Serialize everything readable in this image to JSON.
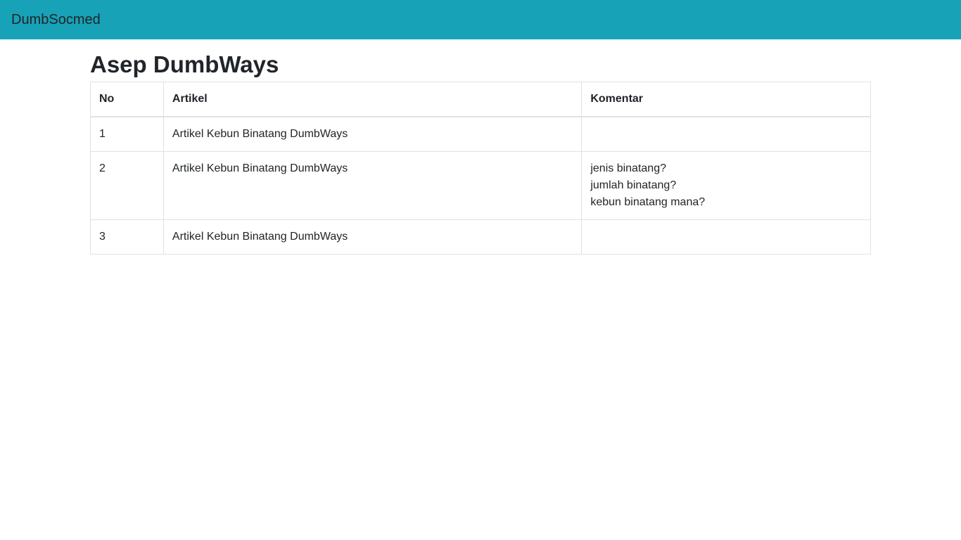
{
  "navbar": {
    "brand": "DumbSocmed",
    "bg_color": "#17a2b8"
  },
  "page": {
    "title": "Asep DumbWays"
  },
  "table": {
    "headers": [
      "No",
      "Artikel",
      "Komentar"
    ],
    "rows": [
      {
        "no": "1",
        "artikel": "Artikel Kebun Binatang DumbWays",
        "komentar": []
      },
      {
        "no": "2",
        "artikel": "Artikel Kebun Binatang DumbWays",
        "komentar": [
          "jenis binatang?",
          "jumlah binatang?",
          "kebun binatang mana?"
        ]
      },
      {
        "no": "3",
        "artikel": "Artikel Kebun Binatang DumbWays",
        "komentar": []
      }
    ]
  }
}
